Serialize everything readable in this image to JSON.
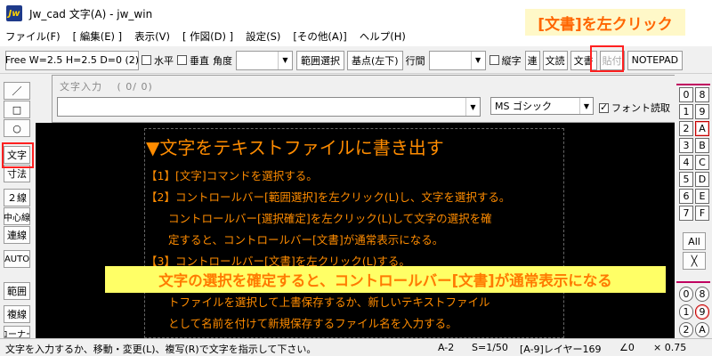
{
  "window": {
    "icon_text": "Jw",
    "title": "Jw_cad 文字(A) - jw_win"
  },
  "menu": [
    "ファイル(F)",
    "[ 編集(E) ]",
    "表示(V)",
    "[ 作図(D) ]",
    "設定(S)",
    "[その他(A)]",
    "ヘルプ(H)"
  ],
  "toolbar": {
    "font_size_btn": "Free  W=2.5 H=2.5 D=0 (2)",
    "horizontal": "水平",
    "vertical": "垂直",
    "angle": "角度",
    "range_select": "範囲選択",
    "base_point": "基点(左下)",
    "line_spacing": "行間",
    "vertical_writing": "縦字",
    "ren": "連",
    "bunyomi": "文読",
    "bunsho": "文書",
    "paste": "貼付",
    "notepad": "NOTEPAD"
  },
  "left_tools": [
    "／",
    "□",
    "○",
    "文字",
    "寸法",
    "２線",
    "中心線",
    "連線",
    "AUTO",
    "範囲",
    "複線",
    "コーナー"
  ],
  "text_panel": {
    "title": "文字入力　 ( 0/ 0)",
    "font_name": "MS ゴシック",
    "font_read": "フォント読取"
  },
  "document": {
    "heading": "▼文字をテキストファイルに書き出す",
    "lines": [
      "【1】[文字]コマンドを選択する。",
      "【2】コントロールバー[範囲選択]を左クリック(L)し、文字を選択する。",
      "　　コントロールバー[選択確定]を左クリック(L)して文字の選択を確",
      "　　定すると、コントロールバー[文書]が通常表示になる。",
      "【3】コントロールバー[文書]を左クリック(L)する。",
      "　　トファイルを選択して上書保存するか、新しいテキストファイル",
      "　　として名前を付けて新規保存するファイル名を入力する。"
    ]
  },
  "layers_top": [
    [
      "0",
      "8"
    ],
    [
      "1",
      "9"
    ],
    [
      "2",
      "A"
    ],
    [
      "3",
      "B"
    ],
    [
      "4",
      "C"
    ],
    [
      "5",
      "D"
    ],
    [
      "6",
      "E"
    ],
    [
      "7",
      "F"
    ]
  ],
  "layer_all": "All",
  "layer_x": "╳",
  "groups_bottom": [
    [
      "0",
      "8"
    ],
    [
      "1",
      "9"
    ],
    [
      "2",
      "A"
    ]
  ],
  "status": {
    "message": "文字を入力するか、移動・変更(L)、複写(R)で文字を指示して下さい。",
    "paper": "A-2",
    "scale": "S=1/50",
    "layer": "[A-9]レイヤー169",
    "angle": "∠0",
    "factor": "× 0.75"
  },
  "annotations": {
    "top": "[文書]を左クリック",
    "banner": "文字の選択を確定すると、コントロールバー[文書]が通常表示になる"
  }
}
